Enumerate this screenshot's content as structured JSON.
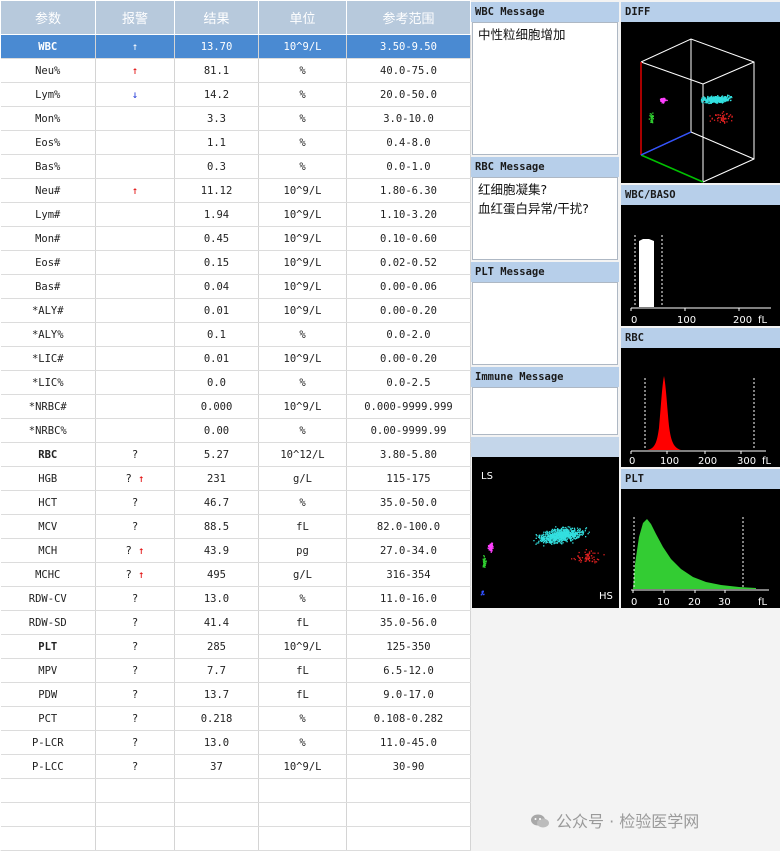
{
  "table": {
    "headers": [
      "参数",
      "报警",
      "结果",
      "单位",
      "参考范围"
    ],
    "rows": [
      [
        "WBC",
        "↑",
        "13.70",
        "10^9/L",
        "3.50-9.50"
      ],
      [
        "Neu%",
        "↑",
        "81.1",
        "%",
        "40.0-75.0"
      ],
      [
        "Lym%",
        "↓",
        "14.2",
        "%",
        "20.0-50.0"
      ],
      [
        "Mon%",
        "",
        "3.3",
        "%",
        "3.0-10.0"
      ],
      [
        "Eos%",
        "",
        "1.1",
        "%",
        "0.4-8.0"
      ],
      [
        "Bas%",
        "",
        "0.3",
        "%",
        "0.0-1.0"
      ],
      [
        "Neu#",
        "↑",
        "11.12",
        "10^9/L",
        "1.80-6.30"
      ],
      [
        "Lym#",
        "",
        "1.94",
        "10^9/L",
        "1.10-3.20"
      ],
      [
        "Mon#",
        "",
        "0.45",
        "10^9/L",
        "0.10-0.60"
      ],
      [
        "Eos#",
        "",
        "0.15",
        "10^9/L",
        "0.02-0.52"
      ],
      [
        "Bas#",
        "",
        "0.04",
        "10^9/L",
        "0.00-0.06"
      ],
      [
        "*ALY#",
        "",
        "0.01",
        "10^9/L",
        "0.00-0.20"
      ],
      [
        "*ALY%",
        "",
        "0.1",
        "%",
        "0.0-2.0"
      ],
      [
        "*LIC#",
        "",
        "0.01",
        "10^9/L",
        "0.00-0.20"
      ],
      [
        "*LIC%",
        "",
        "0.0",
        "%",
        "0.0-2.5"
      ],
      [
        "*NRBC#",
        "",
        "0.000",
        "10^9/L",
        "0.000-9999.999"
      ],
      [
        "*NRBC%",
        "",
        "0.00",
        "%",
        "0.00-9999.99"
      ],
      [
        "RBC",
        "?",
        "5.27",
        "10^12/L",
        "3.80-5.80"
      ],
      [
        "HGB",
        "? ↑",
        "231",
        "g/L",
        "115-175"
      ],
      [
        "HCT",
        "?",
        "46.7",
        "%",
        "35.0-50.0"
      ],
      [
        "MCV",
        "?",
        "88.5",
        "fL",
        "82.0-100.0"
      ],
      [
        "MCH",
        "? ↑",
        "43.9",
        "pg",
        "27.0-34.0"
      ],
      [
        "MCHC",
        "? ↑",
        "495",
        "g/L",
        "316-354"
      ],
      [
        "RDW-CV",
        "?",
        "13.0",
        "%",
        "11.0-16.0"
      ],
      [
        "RDW-SD",
        "?",
        "41.4",
        "fL",
        "35.0-56.0"
      ],
      [
        "PLT",
        "?",
        "285",
        "10^9/L",
        "125-350"
      ],
      [
        "MPV",
        "?",
        "7.7",
        "fL",
        "6.5-12.0"
      ],
      [
        "PDW",
        "?",
        "13.7",
        "fL",
        "9.0-17.0"
      ],
      [
        "PCT",
        "?",
        "0.218",
        "%",
        "0.108-0.282"
      ],
      [
        "P-LCR",
        "?",
        "13.0",
        "%",
        "11.0-45.0"
      ],
      [
        "P-LCC",
        "?",
        "37",
        "10^9/L",
        "30-90"
      ],
      [
        "",
        "",
        "",
        "",
        ""
      ],
      [
        "",
        "",
        "",
        "",
        ""
      ],
      [
        "",
        "",
        "",
        "",
        ""
      ]
    ],
    "bold_rows": [
      0,
      17,
      25
    ],
    "selected_row": 0
  },
  "messages": {
    "wbc": {
      "title": "WBC Message",
      "lines": [
        "中性粒细胞增加"
      ]
    },
    "rbc": {
      "title": "RBC Message",
      "lines": [
        "红细胞凝集?",
        "血红蛋白异常/干扰?"
      ]
    },
    "plt": {
      "title": "PLT Message",
      "lines": []
    },
    "immune": {
      "title": "Immune Message",
      "lines": []
    }
  },
  "plots": {
    "diff": {
      "title": "DIFF"
    },
    "wbc_baso": {
      "title": "WBC/BASO",
      "ticks": [
        "0",
        "100",
        "200"
      ],
      "unit": "fL"
    },
    "rbc": {
      "title": "RBC",
      "ticks": [
        "0",
        "100",
        "200",
        "300"
      ],
      "unit": "fL"
    },
    "plt": {
      "title": "PLT",
      "ticks": [
        "0",
        "10",
        "20",
        "30"
      ],
      "unit": "fL"
    },
    "scatter": {
      "x_label": "HS",
      "y_label": "LS"
    }
  },
  "colors": {
    "header_bg": "#b7c9dc",
    "selected_row": "#4a8ad2",
    "alarm_up": "#e00000",
    "alarm_down": "#1f37d8",
    "rbc_hist": "#ff0000",
    "plt_hist": "#33cc33",
    "baso_hist": "#ffffff"
  },
  "watermark": "公众号 · 检验医学网"
}
